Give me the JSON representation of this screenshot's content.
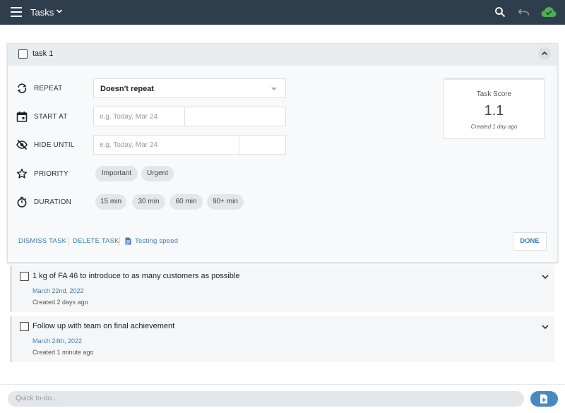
{
  "header": {
    "title": "Tasks",
    "icons": [
      "menu-icon",
      "chevron-down-icon",
      "search-icon",
      "undo-icon",
      "cloud-check-icon"
    ],
    "bar_color": "#2f3e4d",
    "cloud_color": "#4caf50"
  },
  "task_edit": {
    "title": "task 1",
    "repeat": {
      "label": "REPEAT",
      "value": "Doesn't repeat"
    },
    "start_at": {
      "label": "START AT",
      "date_placeholder": "e.g. Today, Mar 24",
      "time_placeholder": ""
    },
    "hide_until": {
      "label": "HIDE UNTIL",
      "date_placeholder": "e.g. Today, Mar 24",
      "time_placeholder": ""
    },
    "priority": {
      "label": "PRIORITY",
      "options": [
        "Important",
        "Urgent"
      ]
    },
    "duration": {
      "label": "DURATION",
      "options": [
        "15 min",
        "30 min",
        "60 min",
        "90+ min"
      ]
    },
    "score": {
      "label": "Task Score",
      "value": "1.1",
      "created": "Created 1 day ago"
    },
    "actions": {
      "dismiss": "DISMISS TASK",
      "delete": "DELETE TASK",
      "note": "Testing speed",
      "done": "DONE"
    }
  },
  "tasks": [
    {
      "title": "1 kg of FA 46 to introduce to as many customers as possible",
      "date": "March 22nd, 2022",
      "created": "Created 2 days ago"
    },
    {
      "title": "Follow up with team on final achievement",
      "date": "March 24th, 2022",
      "created": "Created 1 minute ago"
    }
  ],
  "quick_add": {
    "placeholder": "Quick to-do..."
  },
  "accent_color": "#3f7fb5"
}
